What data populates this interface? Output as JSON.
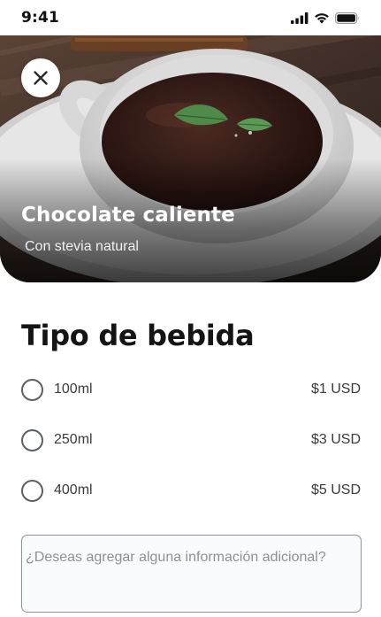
{
  "status_bar": {
    "time": "9:41",
    "icons": [
      "cellular-signal-icon",
      "wifi-icon",
      "battery-icon"
    ]
  },
  "hero": {
    "title": "Chocolate caliente",
    "subtitle": "Con stevia natural",
    "close_icon": "close-icon"
  },
  "section": {
    "title": "Tipo de bebida"
  },
  "options": [
    {
      "label": "100ml",
      "price": "$1 USD",
      "selected": false
    },
    {
      "label": "250ml",
      "price": "$3 USD",
      "selected": false
    },
    {
      "label": "400ml",
      "price": "$5 USD",
      "selected": false
    }
  ],
  "notes": {
    "placeholder": "¿Deseas agregar alguna información adicional?",
    "value": ""
  },
  "colors": {
    "text_primary": "#141414",
    "text_secondary": "#3a3a3c",
    "radio_border": "#5b6065",
    "input_border": "#8e9399",
    "placeholder": "#8d9197"
  }
}
